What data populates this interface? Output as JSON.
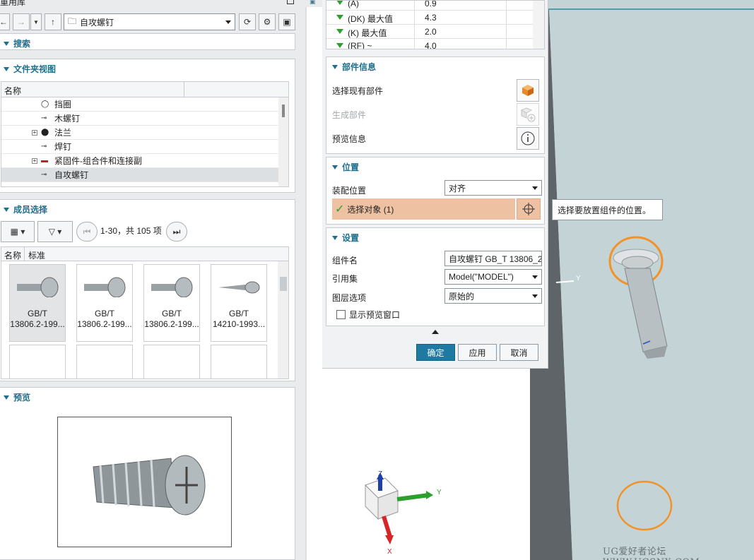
{
  "left": {
    "title_fragment": "重用库",
    "path_value": "自攻螺钉",
    "search_label": "搜索",
    "folder_view_label": "文件夹视图",
    "tree_col_name": "名称",
    "tree_items": [
      "挡圈",
      "木螺钉",
      "法兰",
      "焊钉",
      "紧固件-组合件和连接副",
      "自攻螺钉"
    ],
    "member_select_label": "成员选择",
    "paging_text": "1-30，共 105 项",
    "tabs": [
      "名称",
      "标准"
    ],
    "tiles": [
      {
        "l1": "GB/T",
        "l2": "13806.2-199..."
      },
      {
        "l1": "GB/T",
        "l2": "13806.2-199..."
      },
      {
        "l1": "GB/T",
        "l2": "13806.2-199..."
      },
      {
        "l1": "GB/T",
        "l2": "14210-1993..."
      }
    ],
    "preview_label": "预览"
  },
  "dialog": {
    "rows_top": [
      {
        "label": "(A)",
        "value": "0.9"
      },
      {
        "label": "(DK) 最大值",
        "value": "4.3"
      },
      {
        "label": "(K) 最大值",
        "value": "2.0"
      },
      {
        "label": "(RF) ~",
        "value": "4.0"
      }
    ],
    "part_info_title": "部件信息",
    "select_existing": "选择现有部件",
    "generate_part": "生成部件",
    "preview_info": "预览信息",
    "position_title": "位置",
    "assembly_pos_label": "装配位置",
    "assembly_pos_value": "对齐",
    "select_object": "选择对象 (1)",
    "settings_title": "设置",
    "component_name_label": "组件名",
    "component_name_value": "自攻螺钉 GB_T 13806_2",
    "ref_set_label": "引用集",
    "ref_set_value": "Model(\"MODEL\")",
    "layer_label": "图层选项",
    "layer_value": "原始的",
    "show_preview_window": "显示预览窗口",
    "ok": "确定",
    "apply": "应用",
    "cancel": "取消"
  },
  "viewport": {
    "tooltip": "选择要放置组件的位置。",
    "axis_z": "Z",
    "axis_y": "Y",
    "axis_x": "X",
    "axis_y_small": "Y",
    "watermark": "UG爱好者论坛 WWW.UGSNX.COM"
  }
}
